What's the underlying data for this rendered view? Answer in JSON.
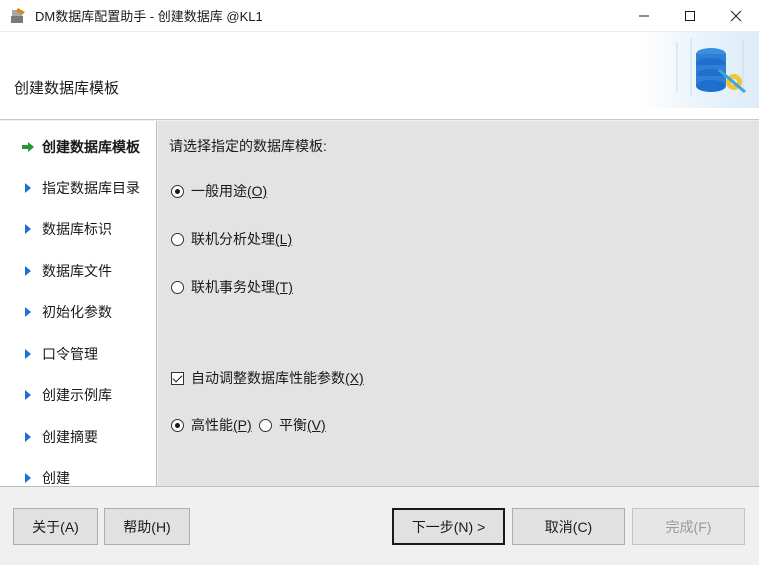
{
  "window": {
    "title": "DM数据库配置助手 - 创建数据库 @KL1",
    "app_icon": "database-tool-icon",
    "controls": [
      "minimize-icon",
      "maximize-icon",
      "close-icon"
    ]
  },
  "header": {
    "title": "创建数据库模板",
    "banner_icon": "database-gear-icon"
  },
  "sidebar": {
    "items": [
      {
        "label": "创建数据库模板",
        "icon": "green-arrow-icon",
        "active": true
      },
      {
        "label": "指定数据库目录",
        "icon": "blue-triangle-icon"
      },
      {
        "label": "数据库标识",
        "icon": "blue-triangle-icon"
      },
      {
        "label": "数据库文件",
        "icon": "blue-triangle-icon"
      },
      {
        "label": "初始化参数",
        "icon": "blue-triangle-icon"
      },
      {
        "label": "口令管理",
        "icon": "blue-triangle-icon"
      },
      {
        "label": "创建示例库",
        "icon": "blue-triangle-icon"
      },
      {
        "label": "创建摘要",
        "icon": "blue-triangle-icon"
      },
      {
        "label": "创建",
        "icon": "blue-triangle-icon"
      }
    ]
  },
  "content": {
    "prompt": "请选择指定的数据库模板:",
    "templates": [
      {
        "label": "一般用途",
        "mnemonic": "(O)",
        "selected": true
      },
      {
        "label": "联机分析处理",
        "mnemonic": "(L)",
        "selected": false
      },
      {
        "label": "联机事务处理",
        "mnemonic": "(T)",
        "selected": false
      }
    ],
    "auto_tune": {
      "label": "自动调整数据库性能参数",
      "mnemonic": "(X)",
      "checked": true
    },
    "modes": [
      {
        "label": "高性能",
        "mnemonic": "(P)",
        "selected": true
      },
      {
        "label": "平衡",
        "mnemonic": "(V)",
        "selected": false
      }
    ]
  },
  "footer": {
    "about": "关于(A)",
    "help": "帮助(H)",
    "next": "下一步(N) >",
    "cancel": "取消(C)",
    "finish": "完成(F)"
  }
}
